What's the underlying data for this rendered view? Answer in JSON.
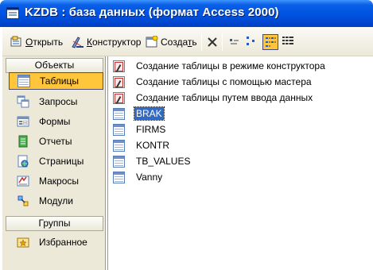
{
  "window": {
    "title": "KZDB : база данных (формат Access 2000)"
  },
  "toolbar": {
    "open_prefix": "О",
    "open_rest": "ткрыть",
    "design_prefix": "К",
    "design_rest": "онструктор",
    "create_main": "Созда",
    "create_underlined": "т",
    "create_rest": "ь"
  },
  "leftpane": {
    "objects_header": "Объекты",
    "groups_header": "Группы",
    "items": [
      {
        "label": "Таблицы",
        "icon": "table-icon"
      },
      {
        "label": "Запросы",
        "icon": "query-icon"
      },
      {
        "label": "Формы",
        "icon": "form-icon"
      },
      {
        "label": "Отчеты",
        "icon": "report-icon"
      },
      {
        "label": "Страницы",
        "icon": "page-icon"
      },
      {
        "label": "Макросы",
        "icon": "macro-icon"
      },
      {
        "label": "Модули",
        "icon": "module-icon"
      }
    ],
    "favorites": "Избранное"
  },
  "objects": {
    "wizards": [
      "Создание таблицы в режиме конструктора",
      "Создание таблицы с помощью мастера",
      "Создание таблицы путем ввода данных"
    ],
    "tables": [
      "BRAK",
      "FIRMS",
      "KONTR",
      "TB_VALUES",
      "Vanny"
    ],
    "selected": "BRAK"
  },
  "colors": {
    "titlebar": "#0054e3",
    "highlight": "#ffc53b",
    "selection": "#316ac5"
  }
}
